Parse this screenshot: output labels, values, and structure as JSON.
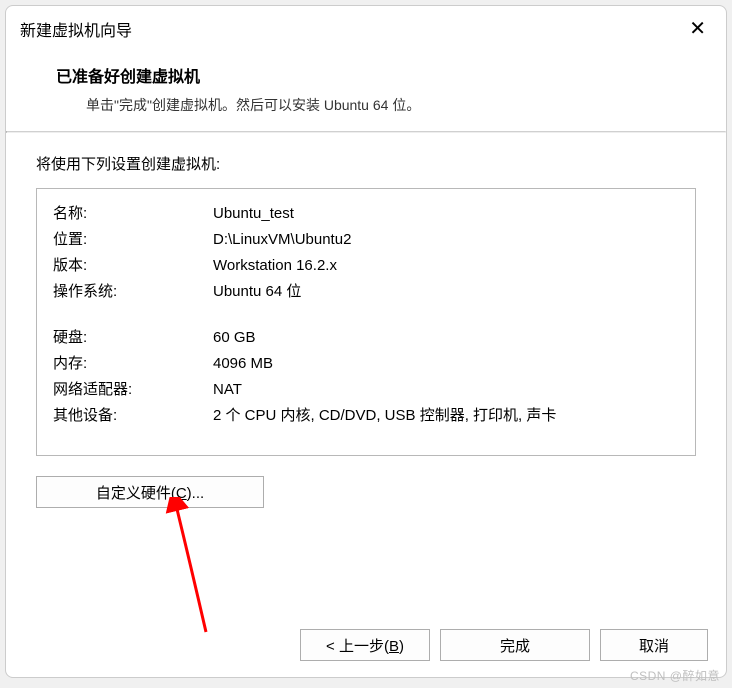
{
  "dialog": {
    "title": "新建虚拟机向导",
    "close_glyph": "✕"
  },
  "header": {
    "heading": "已准备好创建虚拟机",
    "subtext": "单击\"完成\"创建虚拟机。然后可以安装 Ubuntu 64 位。"
  },
  "body": {
    "intro": "将使用下列设置创建虚拟机:",
    "settings_group1": [
      {
        "label": "名称:",
        "value": "Ubuntu_test"
      },
      {
        "label": "位置:",
        "value": "D:\\LinuxVM\\Ubuntu2"
      },
      {
        "label": "版本:",
        "value": "Workstation 16.2.x"
      },
      {
        "label": "操作系统:",
        "value": "Ubuntu 64 位"
      }
    ],
    "settings_group2": [
      {
        "label": "硬盘:",
        "value": "60 GB"
      },
      {
        "label": "内存:",
        "value": "4096 MB"
      },
      {
        "label": "网络适配器:",
        "value": "NAT"
      },
      {
        "label": "其他设备:",
        "value": "2 个 CPU 内核, CD/DVD, USB 控制器, 打印机, 声卡"
      }
    ],
    "customize_prefix": "自定义硬件(",
    "customize_hotkey": "C",
    "customize_suffix": ")..."
  },
  "footer": {
    "back_prefix": "< 上一步(",
    "back_hotkey": "B",
    "back_suffix": ")",
    "finish": "完成",
    "cancel": "取消"
  },
  "watermark": "CSDN @醉如意",
  "annotation": {
    "arrow_color": "#ff0000"
  }
}
